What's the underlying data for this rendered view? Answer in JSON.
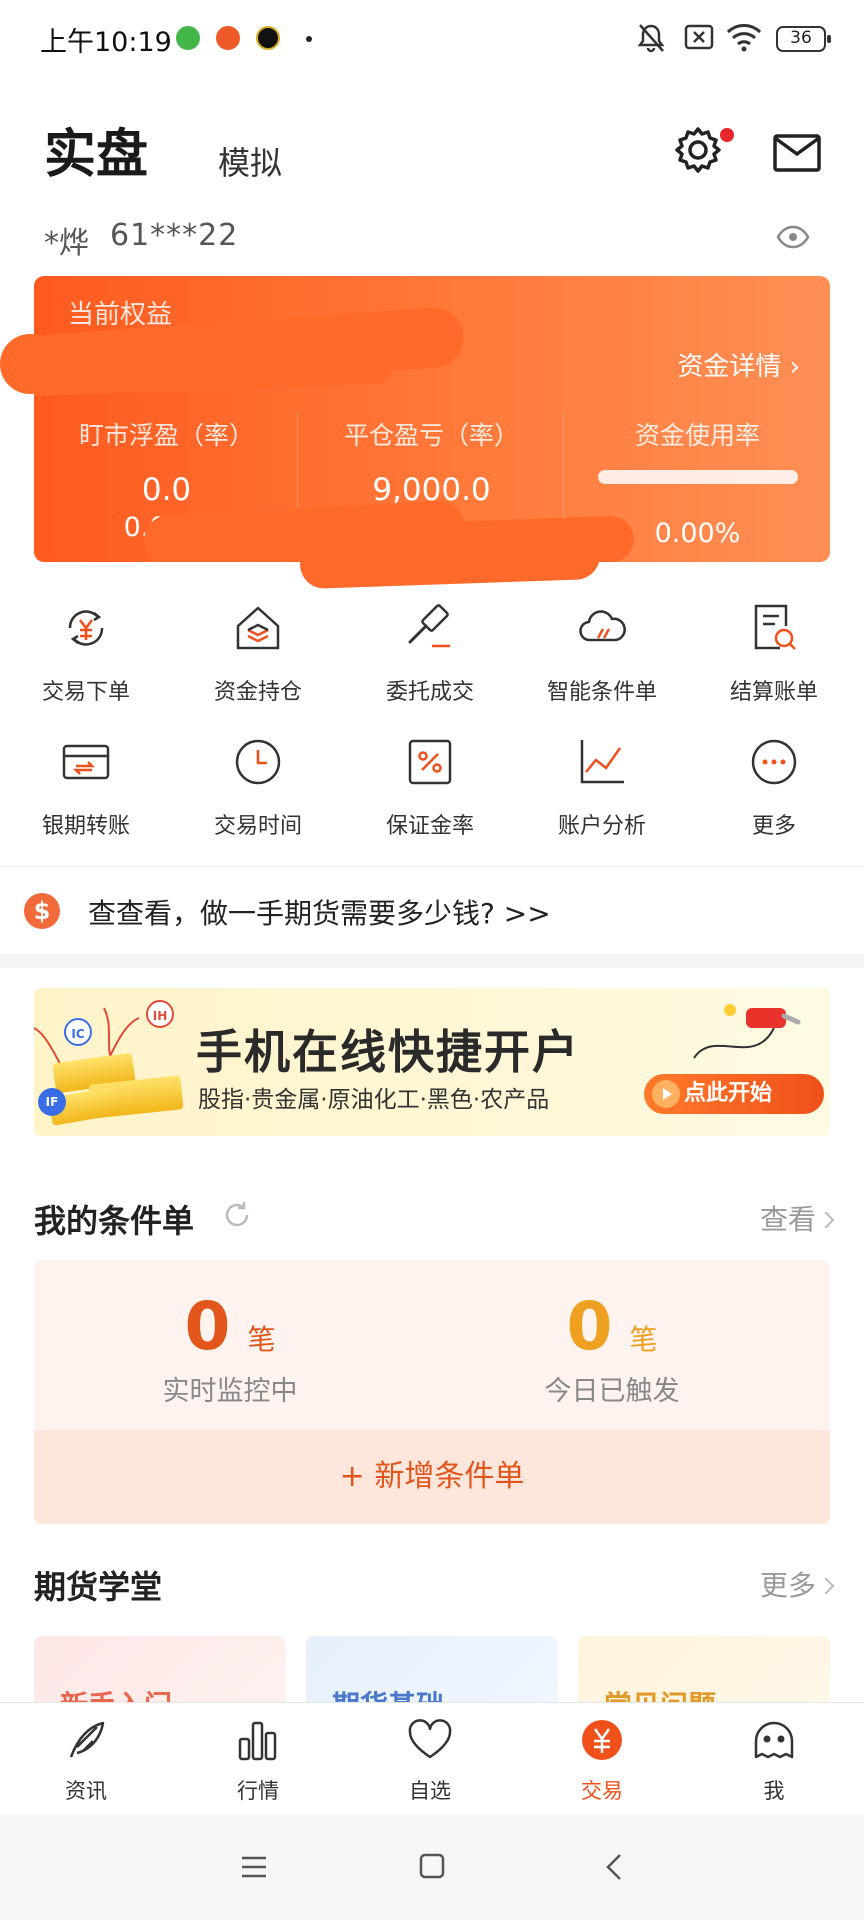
{
  "status_bar": {
    "time": "上午10:19",
    "battery": "36"
  },
  "header": {
    "tab_real": "实盘",
    "tab_sim": "模拟",
    "account_name": "*烨",
    "account_no": "61***22"
  },
  "equity_card": {
    "title": "当前权益",
    "detail_link": "资金详情 ›",
    "columns": [
      {
        "label": "盯市浮盈（率）",
        "value": "0.0",
        "sub": "0.00%"
      },
      {
        "label": "平仓盈亏（率）",
        "value": "9,000.0",
        "sub": ""
      },
      {
        "label": "资金使用率",
        "value": "",
        "sub": "0.00%"
      }
    ],
    "usage_rate": 0.0
  },
  "grid": [
    {
      "label": "交易下单",
      "icon": "yuan-exchange-icon"
    },
    {
      "label": "资金持仓",
      "icon": "house-layers-icon"
    },
    {
      "label": "委托成交",
      "icon": "gavel-icon"
    },
    {
      "label": "智能条件单",
      "icon": "cloud-icon"
    },
    {
      "label": "结算账单",
      "icon": "bill-search-icon"
    },
    {
      "label": "银期转账",
      "icon": "card-transfer-icon"
    },
    {
      "label": "交易时间",
      "icon": "clock-icon"
    },
    {
      "label": "保证金率",
      "icon": "percent-icon"
    },
    {
      "label": "账户分析",
      "icon": "line-chart-icon"
    },
    {
      "label": "更多",
      "icon": "more-dots-icon"
    }
  ],
  "tip": {
    "icon_text": "$",
    "text": "查查看，做一手期货需要多少钱? >>"
  },
  "banner": {
    "title": "手机在线快捷开户",
    "subtitle": "股指·贵金属·原油化工·黑色·农产品",
    "button": "点此开始",
    "tags": [
      "IC",
      "IH",
      "IF"
    ]
  },
  "conditions": {
    "title": "我的条件单",
    "view_link": "查看",
    "monitoring": {
      "count": "0",
      "unit": "笔",
      "label": "实时监控中"
    },
    "triggered": {
      "count": "0",
      "unit": "笔",
      "label": "今日已触发"
    },
    "add_button": "+  新增条件单"
  },
  "school": {
    "title": "期货学堂",
    "more_link": "更多",
    "cards": [
      "新手入门",
      "期货基础",
      "常见问题"
    ]
  },
  "bottom_nav": [
    {
      "label": "资讯",
      "icon": "feather-icon"
    },
    {
      "label": "行情",
      "icon": "bar-chart-icon"
    },
    {
      "label": "自选",
      "icon": "heart-icon"
    },
    {
      "label": "交易",
      "icon": "yuan-circle-icon"
    },
    {
      "label": "我",
      "icon": "face-icon"
    }
  ],
  "colors": {
    "accent": "#ff6a2a",
    "nav_active": "#f0501a",
    "monitor_count": "#e2561b",
    "triggered_count": "#f0a020"
  }
}
